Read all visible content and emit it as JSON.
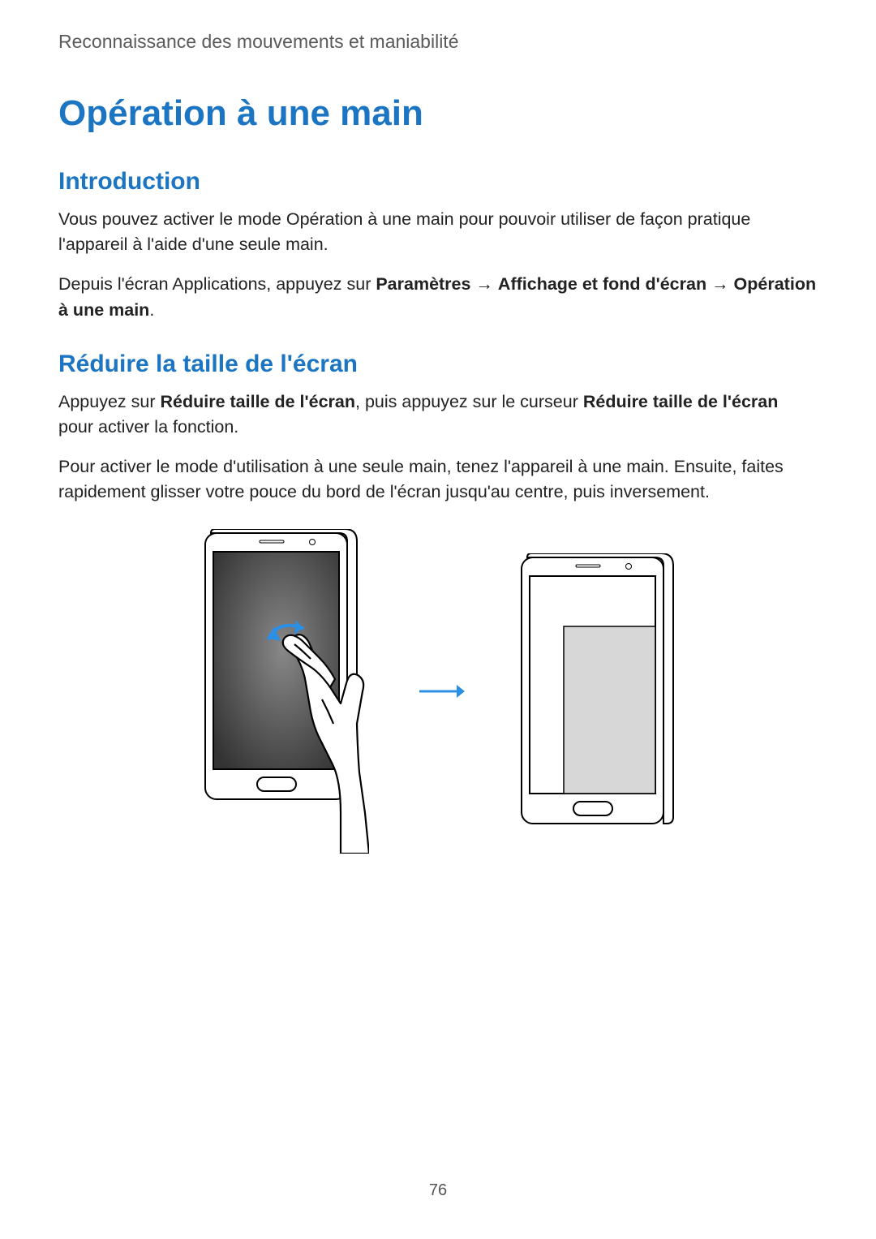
{
  "breadcrumb": "Reconnaissance des mouvements et maniabilité",
  "title": "Opération à une main",
  "introduction": {
    "heading": "Introduction",
    "para1": "Vous pouvez activer le mode Opération à une main pour pouvoir utiliser de façon pratique l'appareil à l'aide d'une seule main.",
    "para2_pre": "Depuis l'écran Applications, appuyez sur ",
    "para2_bold1": "Paramètres",
    "para2_arrow1": " → ",
    "para2_bold2": "Affichage et fond d'écran",
    "para2_arrow2": " → ",
    "para2_bold3": "Opération à une main",
    "para2_post": "."
  },
  "reduce": {
    "heading": "Réduire la taille de l'écran",
    "para1_pre": "Appuyez sur ",
    "para1_bold1": "Réduire taille de l'écran",
    "para1_mid": ", puis appuyez sur le curseur ",
    "para1_bold2": "Réduire taille de l'écran",
    "para1_post": " pour activer la fonction.",
    "para2": "Pour activer le mode d'utilisation à une seule main, tenez l'appareil à une main. Ensuite, faites rapidement glisser votre pouce du bord de l'écran jusqu'au centre, puis inversement."
  },
  "page_number": "76",
  "colors": {
    "accent_blue": "#1c75c2",
    "text_dark": "#222222",
    "text_muted": "#5a5a5a"
  }
}
